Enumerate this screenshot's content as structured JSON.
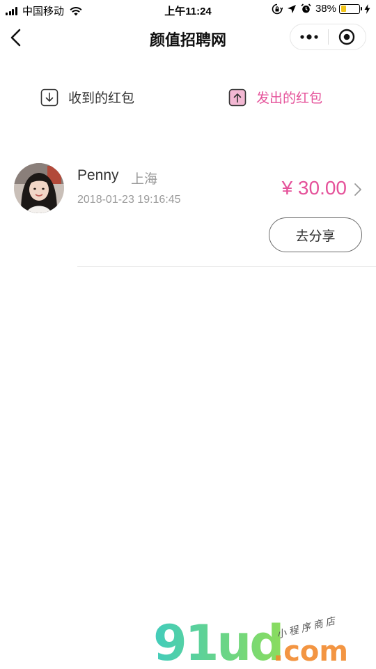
{
  "status_bar": {
    "carrier": "中国移动",
    "time": "上午11:24",
    "battery_percent": "38%",
    "battery_level": 0.38,
    "battery_color": "#f2c51a",
    "icons": [
      "signal-icon",
      "wifi-icon",
      "rotation-lock-icon",
      "location-icon",
      "alarm-icon",
      "battery-icon",
      "charging-icon"
    ]
  },
  "navbar": {
    "title": "颜值招聘网",
    "back_icon": "back-arrow-icon",
    "more_icon": "more-dots-icon",
    "close_icon": "target-close-icon"
  },
  "tabs": [
    {
      "label": "收到的红包",
      "icon": "download-box-icon",
      "active": false
    },
    {
      "label": "发出的红包",
      "icon": "upload-box-icon",
      "active": true
    }
  ],
  "accent_color": "#e5529a",
  "records": [
    {
      "name": "Penny",
      "city": "上海",
      "time": "2018-01-23 19:16:45",
      "amount": "¥ 30.00",
      "action_label": "去分享"
    }
  ],
  "watermark": {
    "logo": "91ud",
    "domain": ".com",
    "subtitle": "小程序商店"
  }
}
